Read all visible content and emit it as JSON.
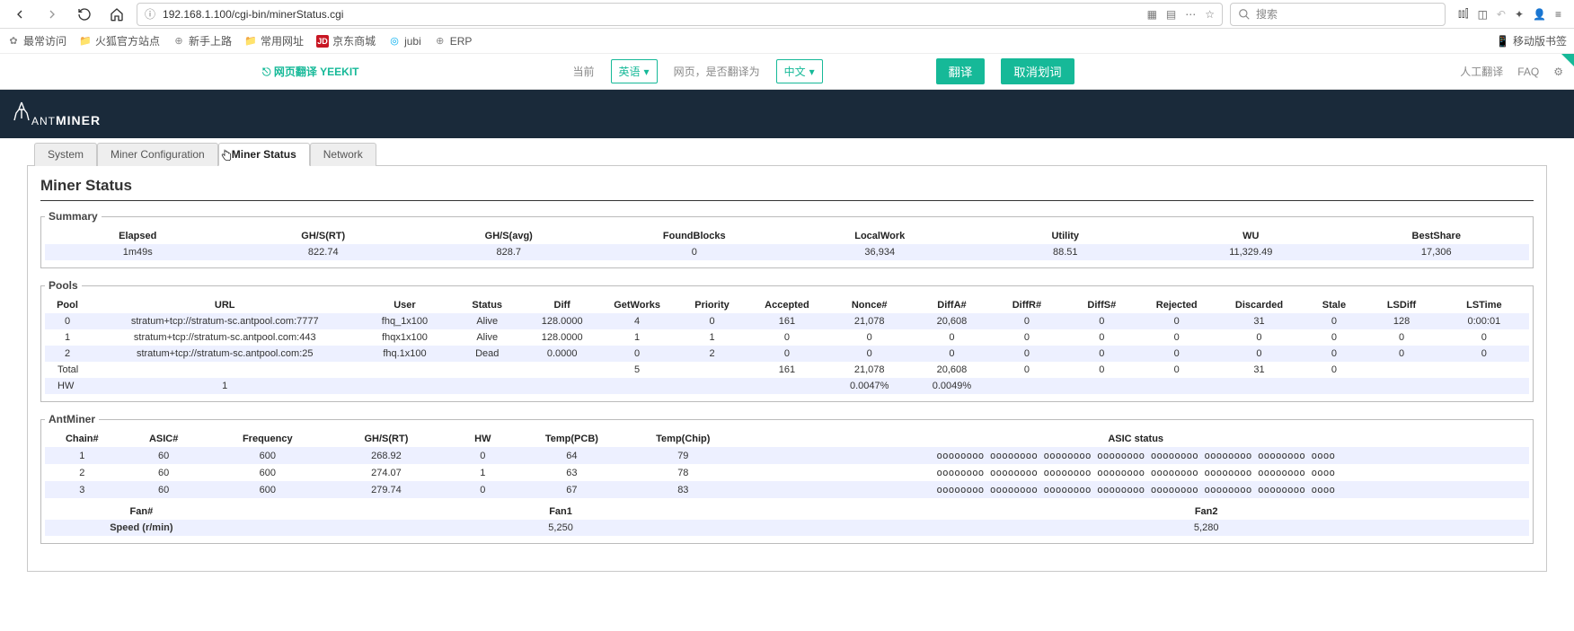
{
  "browser": {
    "url": "192.168.1.100/cgi-bin/minerStatus.cgi",
    "search_placeholder": "搜索",
    "bookmarks": {
      "most_visited": "最常访问",
      "firefox_official": "火狐官方站点",
      "new_user": "新手上路",
      "common_url": "常用网址",
      "jd": "京东商城",
      "jubi": "jubi",
      "erp": "ERP",
      "mobile_bookmarks": "移动版书签"
    }
  },
  "translate": {
    "brand": "网页翻译  YEEKIT",
    "current": "当前",
    "lang_from": "英语",
    "question": "网页，是否翻译为",
    "lang_to": "中文",
    "translate_btn": "翻译",
    "cancel_btn": "取消划词",
    "human": "人工翻译",
    "faq": "FAQ"
  },
  "header": {
    "brand1": "ANT",
    "brand2": "MINER"
  },
  "tabs": {
    "t0": "System",
    "t1": "Miner Configuration",
    "t2": "Miner Status",
    "t3": "Network"
  },
  "page": {
    "title": "Miner Status"
  },
  "summary": {
    "legend": "Summary",
    "h": {
      "elapsed": "Elapsed",
      "ghsrt": "GH/S(RT)",
      "ghsavg": "GH/S(avg)",
      "found": "FoundBlocks",
      "local": "LocalWork",
      "utility": "Utility",
      "wu": "WU",
      "best": "BestShare"
    },
    "v": {
      "elapsed": "1m49s",
      "ghsrt": "822.74",
      "ghsavg": "828.7",
      "found": "0",
      "local": "36,934",
      "utility": "88.51",
      "wu": "11,329.49",
      "best": "17,306"
    }
  },
  "pools": {
    "legend": "Pools",
    "h": {
      "pool": "Pool",
      "url": "URL",
      "user": "User",
      "status": "Status",
      "diff": "Diff",
      "getworks": "GetWorks",
      "priority": "Priority",
      "accepted": "Accepted",
      "nonce": "Nonce#",
      "diffa": "DiffA#",
      "diffr": "DiffR#",
      "diffs": "DiffS#",
      "rejected": "Rejected",
      "discarded": "Discarded",
      "stale": "Stale",
      "lsdiff": "LSDiff",
      "lstime": "LSTime"
    },
    "r0": {
      "pool": "0",
      "url": "stratum+tcp://stratum-sc.antpool.com:7777",
      "user": "fhq_1x100",
      "status": "Alive",
      "diff": "128.0000",
      "getworks": "4",
      "priority": "0",
      "accepted": "161",
      "nonce": "21,078",
      "diffa": "20,608",
      "diffr": "0",
      "diffs": "0",
      "rejected": "0",
      "discarded": "31",
      "stale": "0",
      "lsdiff": "128",
      "lstime": "0:00:01"
    },
    "r1": {
      "pool": "1",
      "url": "stratum+tcp://stratum-sc.antpool.com:443",
      "user": "fhqx1x100",
      "status": "Alive",
      "diff": "128.0000",
      "getworks": "1",
      "priority": "1",
      "accepted": "0",
      "nonce": "0",
      "diffa": "0",
      "diffr": "0",
      "diffs": "0",
      "rejected": "0",
      "discarded": "0",
      "stale": "0",
      "lsdiff": "0",
      "lstime": "0"
    },
    "r2": {
      "pool": "2",
      "url": "stratum+tcp://stratum-sc.antpool.com:25",
      "user": "fhq.1x100",
      "status": "Dead",
      "diff": "0.0000",
      "getworks": "0",
      "priority": "2",
      "accepted": "0",
      "nonce": "0",
      "diffa": "0",
      "diffr": "0",
      "diffs": "0",
      "rejected": "0",
      "discarded": "0",
      "stale": "0",
      "lsdiff": "0",
      "lstime": "0"
    },
    "total": {
      "pool": "Total",
      "url": "",
      "user": "",
      "status": "",
      "diff": "",
      "getworks": "5",
      "priority": "",
      "accepted": "161",
      "nonce": "21,078",
      "diffa": "20,608",
      "diffr": "0",
      "diffs": "0",
      "rejected": "0",
      "discarded": "31",
      "stale": "0",
      "lsdiff": "",
      "lstime": ""
    },
    "hw": {
      "pool": "HW",
      "url": "1",
      "nonce": "0.0047%",
      "diffa": "0.0049%"
    }
  },
  "antminer": {
    "legend": "AntMiner",
    "h": {
      "chain": "Chain#",
      "asic": "ASIC#",
      "freq": "Frequency",
      "ghs": "GH/S(RT)",
      "hw": "HW",
      "tpcb": "Temp(PCB)",
      "tchip": "Temp(Chip)",
      "status": "ASIC status"
    },
    "r0": {
      "chain": "1",
      "asic": "60",
      "freq": "600",
      "ghs": "268.92",
      "hw": "0",
      "tpcb": "64",
      "tchip": "79",
      "status": "oooooooo oooooooo oooooooo oooooooo oooooooo oooooooo oooooooo oooo"
    },
    "r1": {
      "chain": "2",
      "asic": "60",
      "freq": "600",
      "ghs": "274.07",
      "hw": "1",
      "tpcb": "63",
      "tchip": "78",
      "status": "oooooooo oooooooo oooooooo oooooooo oooooooo oooooooo oooooooo oooo"
    },
    "r2": {
      "chain": "3",
      "asic": "60",
      "freq": "600",
      "ghs": "279.74",
      "hw": "0",
      "tpcb": "67",
      "tchip": "83",
      "status": "oooooooo oooooooo oooooooo oooooooo oooooooo oooooooo oooooooo oooo"
    },
    "fanH": {
      "fannum": "Fan#",
      "fan1": "Fan1",
      "fan2": "Fan2"
    },
    "fanV": {
      "fannum": "Speed (r/min)",
      "fan1": "5,250",
      "fan2": "5,280"
    }
  }
}
